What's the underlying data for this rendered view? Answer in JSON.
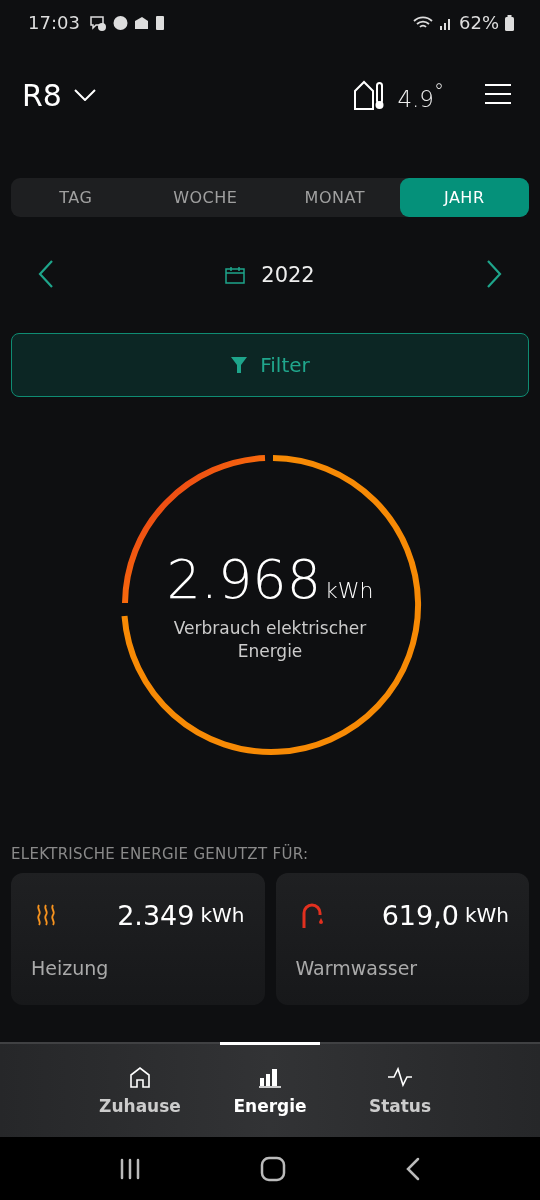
{
  "status_bar": {
    "time": "17:03",
    "battery": "62%"
  },
  "header": {
    "title": "R8",
    "temperature": "4.9",
    "degree": "°"
  },
  "tabs": [
    {
      "label": "TAG",
      "selected": false
    },
    {
      "label": "WOCHE",
      "selected": false
    },
    {
      "label": "MONAT",
      "selected": false
    },
    {
      "label": "JAHR",
      "selected": true
    }
  ],
  "period": {
    "label": "2022"
  },
  "filter": {
    "label": "Filter"
  },
  "total": {
    "value": "2.968",
    "unit": "kWh",
    "caption": "Verbrauch elektrischer Energie"
  },
  "section_title": "ELEKTRISCHE ENERGIE GENUTZT FÜR:",
  "cards": [
    {
      "kind": "heating",
      "value": "2.349",
      "unit": "kWh",
      "label": "Heizung"
    },
    {
      "kind": "water",
      "value": "619,0",
      "unit": "kWh",
      "label": "Warmwasser"
    }
  ],
  "bottom_nav": [
    {
      "kind": "home",
      "label": "Zuhause",
      "selected": false
    },
    {
      "kind": "energy",
      "label": "Energie",
      "selected": true
    },
    {
      "kind": "status",
      "label": "Status",
      "selected": false
    }
  ]
}
